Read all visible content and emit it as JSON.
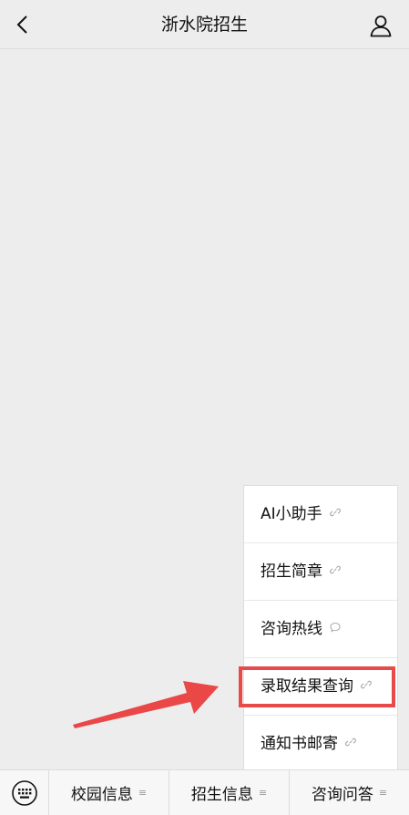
{
  "header": {
    "title": "浙水院招生"
  },
  "popup_menu": {
    "items": [
      {
        "label": "AI小助手",
        "icon": "link-icon"
      },
      {
        "label": "招生简章",
        "icon": "link-icon"
      },
      {
        "label": "咨询热线",
        "icon": "chat-bubble-icon"
      },
      {
        "label": "录取结果查询",
        "icon": "link-icon",
        "highlighted": true
      },
      {
        "label": "通知书邮寄",
        "icon": "link-icon"
      }
    ]
  },
  "bottom_menu": {
    "tabs": [
      {
        "label": "校园信息",
        "icon": "menu-lines-icon"
      },
      {
        "label": "招生信息",
        "icon": "menu-lines-icon"
      },
      {
        "label": "咨询问答",
        "icon": "menu-lines-icon"
      }
    ]
  },
  "colors": {
    "background": "#ededed",
    "highlight": "#e84a4a",
    "text": "#111111"
  }
}
